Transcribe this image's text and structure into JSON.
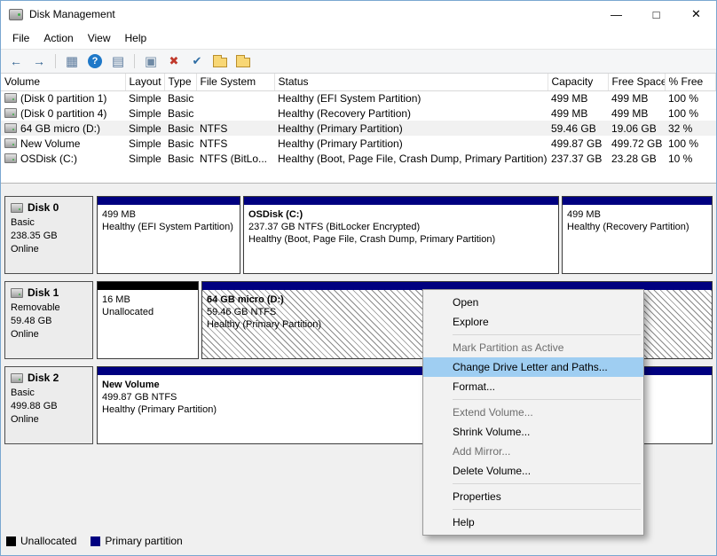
{
  "window": {
    "title": "Disk Management",
    "controls": {
      "minimize": "—",
      "maximize": "□",
      "close": "✕"
    }
  },
  "menu_bar": {
    "items": [
      "File",
      "Action",
      "View",
      "Help"
    ]
  },
  "toolbar": {
    "icons": [
      {
        "name": "back-icon",
        "glyph": "←"
      },
      {
        "name": "forward-icon",
        "glyph": "→"
      },
      {
        "name": "console-tree-icon",
        "glyph": "▦"
      },
      {
        "name": "help-icon",
        "glyph": "?"
      },
      {
        "name": "show-list-icon",
        "glyph": "▤"
      },
      {
        "name": "action-pane-icon",
        "glyph": "▣"
      },
      {
        "name": "delete-icon",
        "glyph": "✖"
      },
      {
        "name": "check-disk-icon",
        "glyph": "✔"
      },
      {
        "name": "folder-open-icon",
        "glyph": ""
      },
      {
        "name": "folder-search-icon",
        "glyph": ""
      }
    ]
  },
  "volume_table": {
    "columns": [
      "Volume",
      "Layout",
      "Type",
      "File System",
      "Status",
      "Capacity",
      "Free Space",
      "% Free"
    ],
    "rows": [
      {
        "volume": "(Disk 0 partition 1)",
        "layout": "Simple",
        "type": "Basic",
        "file_system": "",
        "status": "Healthy (EFI System Partition)",
        "capacity": "499 MB",
        "free_space": "499 MB",
        "pct_free": "100 %"
      },
      {
        "volume": "(Disk 0 partition 4)",
        "layout": "Simple",
        "type": "Basic",
        "file_system": "",
        "status": "Healthy (Recovery Partition)",
        "capacity": "499 MB",
        "free_space": "499 MB",
        "pct_free": "100 %"
      },
      {
        "volume": "64 GB micro (D:)",
        "layout": "Simple",
        "type": "Basic",
        "file_system": "NTFS",
        "status": "Healthy (Primary Partition)",
        "capacity": "59.46 GB",
        "free_space": "19.06 GB",
        "pct_free": "32 %"
      },
      {
        "volume": "New Volume",
        "layout": "Simple",
        "type": "Basic",
        "file_system": "NTFS",
        "status": "Healthy (Primary Partition)",
        "capacity": "499.87 GB",
        "free_space": "499.72 GB",
        "pct_free": "100 %"
      },
      {
        "volume": "OSDisk (C:)",
        "layout": "Simple",
        "type": "Basic",
        "file_system": "NTFS (BitLo...",
        "status": "Healthy (Boot, Page File, Crash Dump, Primary Partition)",
        "capacity": "237.37 GB",
        "free_space": "23.28 GB",
        "pct_free": "10 %"
      }
    ]
  },
  "disks": [
    {
      "name": "Disk 0",
      "type": "Basic",
      "size": "238.35 GB",
      "status": "Online",
      "partitions": [
        {
          "title": "",
          "line1": "499 MB",
          "line2": "Healthy (EFI System Partition)"
        },
        {
          "title": "OSDisk (C:)",
          "line1": "237.37 GB NTFS (BitLocker Encrypted)",
          "line2": "Healthy (Boot, Page File, Crash Dump, Primary Partition)"
        },
        {
          "title": "",
          "line1": "499 MB",
          "line2": "Healthy (Recovery Partition)"
        }
      ]
    },
    {
      "name": "Disk 1",
      "type": "Removable",
      "size": "59.48 GB",
      "status": "Online",
      "partitions": [
        {
          "title": "",
          "line1": "16 MB",
          "line2": "Unallocated"
        },
        {
          "title": "64 GB micro (D:)",
          "line1": "59.46 GB NTFS",
          "line2": "Healthy (Primary Partition)"
        }
      ]
    },
    {
      "name": "Disk 2",
      "type": "Basic",
      "size": "499.88 GB",
      "status": "Online",
      "partitions": [
        {
          "title": "New Volume",
          "line1": "499.87 GB NTFS",
          "line2": "Healthy (Primary Partition)"
        }
      ]
    }
  ],
  "context_menu": {
    "items": [
      {
        "label": "Open",
        "state": "normal"
      },
      {
        "label": "Explore",
        "state": "normal"
      },
      {
        "label": "Mark Partition as Active",
        "state": "disabled"
      },
      {
        "label": "Change Drive Letter and Paths...",
        "state": "highlighted"
      },
      {
        "label": "Format...",
        "state": "normal"
      },
      {
        "label": "Extend Volume...",
        "state": "disabled"
      },
      {
        "label": "Shrink Volume...",
        "state": "normal"
      },
      {
        "label": "Add Mirror...",
        "state": "disabled"
      },
      {
        "label": "Delete Volume...",
        "state": "normal"
      },
      {
        "label": "Properties",
        "state": "normal"
      },
      {
        "label": "Help",
        "state": "normal"
      }
    ]
  },
  "legend": {
    "items": [
      {
        "label": "Unallocated",
        "color": "#000000"
      },
      {
        "label": "Primary partition",
        "color": "#000080"
      }
    ]
  },
  "colors": {
    "primary_partition_bar": "#000080",
    "unallocated_bar": "#000000",
    "menu_highlight": "#9fcef2",
    "window_border": "#7aa7d0"
  }
}
